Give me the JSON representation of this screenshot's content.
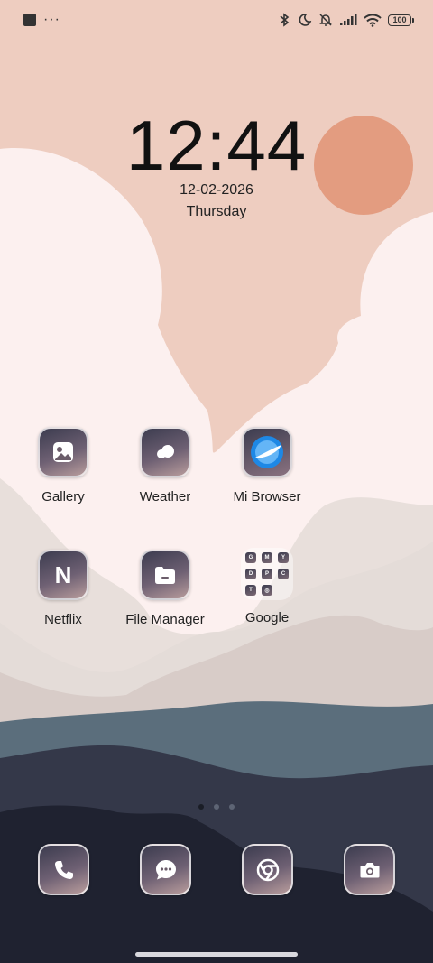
{
  "status_bar": {
    "battery_level": "100",
    "left_icons": [
      "notification-square-icon",
      "more-dots-icon"
    ],
    "right_icons": [
      "bluetooth-icon",
      "moon-icon",
      "bell-off-icon",
      "signal-icon",
      "wifi-icon",
      "battery-icon"
    ],
    "more": "···"
  },
  "clock": {
    "time": "12:44",
    "date": "12-02-2026",
    "day": "Thursday"
  },
  "apps": [
    {
      "label": "Gallery",
      "icon": "gallery-icon"
    },
    {
      "label": "Weather",
      "icon": "weather-icon"
    },
    {
      "label": "Mi Browser",
      "icon": "mi-browser-icon"
    },
    {
      "label": "Netflix",
      "icon": "netflix-icon",
      "glyph": "N"
    },
    {
      "label": "File Manager",
      "icon": "folder-icon"
    },
    {
      "label": "Google",
      "icon": "google-folder-icon"
    }
  ],
  "google_folder_icons": [
    "G",
    "M",
    "Y",
    "D",
    "P",
    "C",
    "T",
    "◎"
  ],
  "page_indicator": {
    "count": 3,
    "active": 1
  },
  "dock": [
    "phone-icon",
    "messages-icon",
    "chrome-icon",
    "camera-icon"
  ],
  "colors": {
    "sun": "#e39c80",
    "sky": "#eecdc0",
    "cloud": "#fcf0ef",
    "icon_dark": "#3c3c4f"
  }
}
